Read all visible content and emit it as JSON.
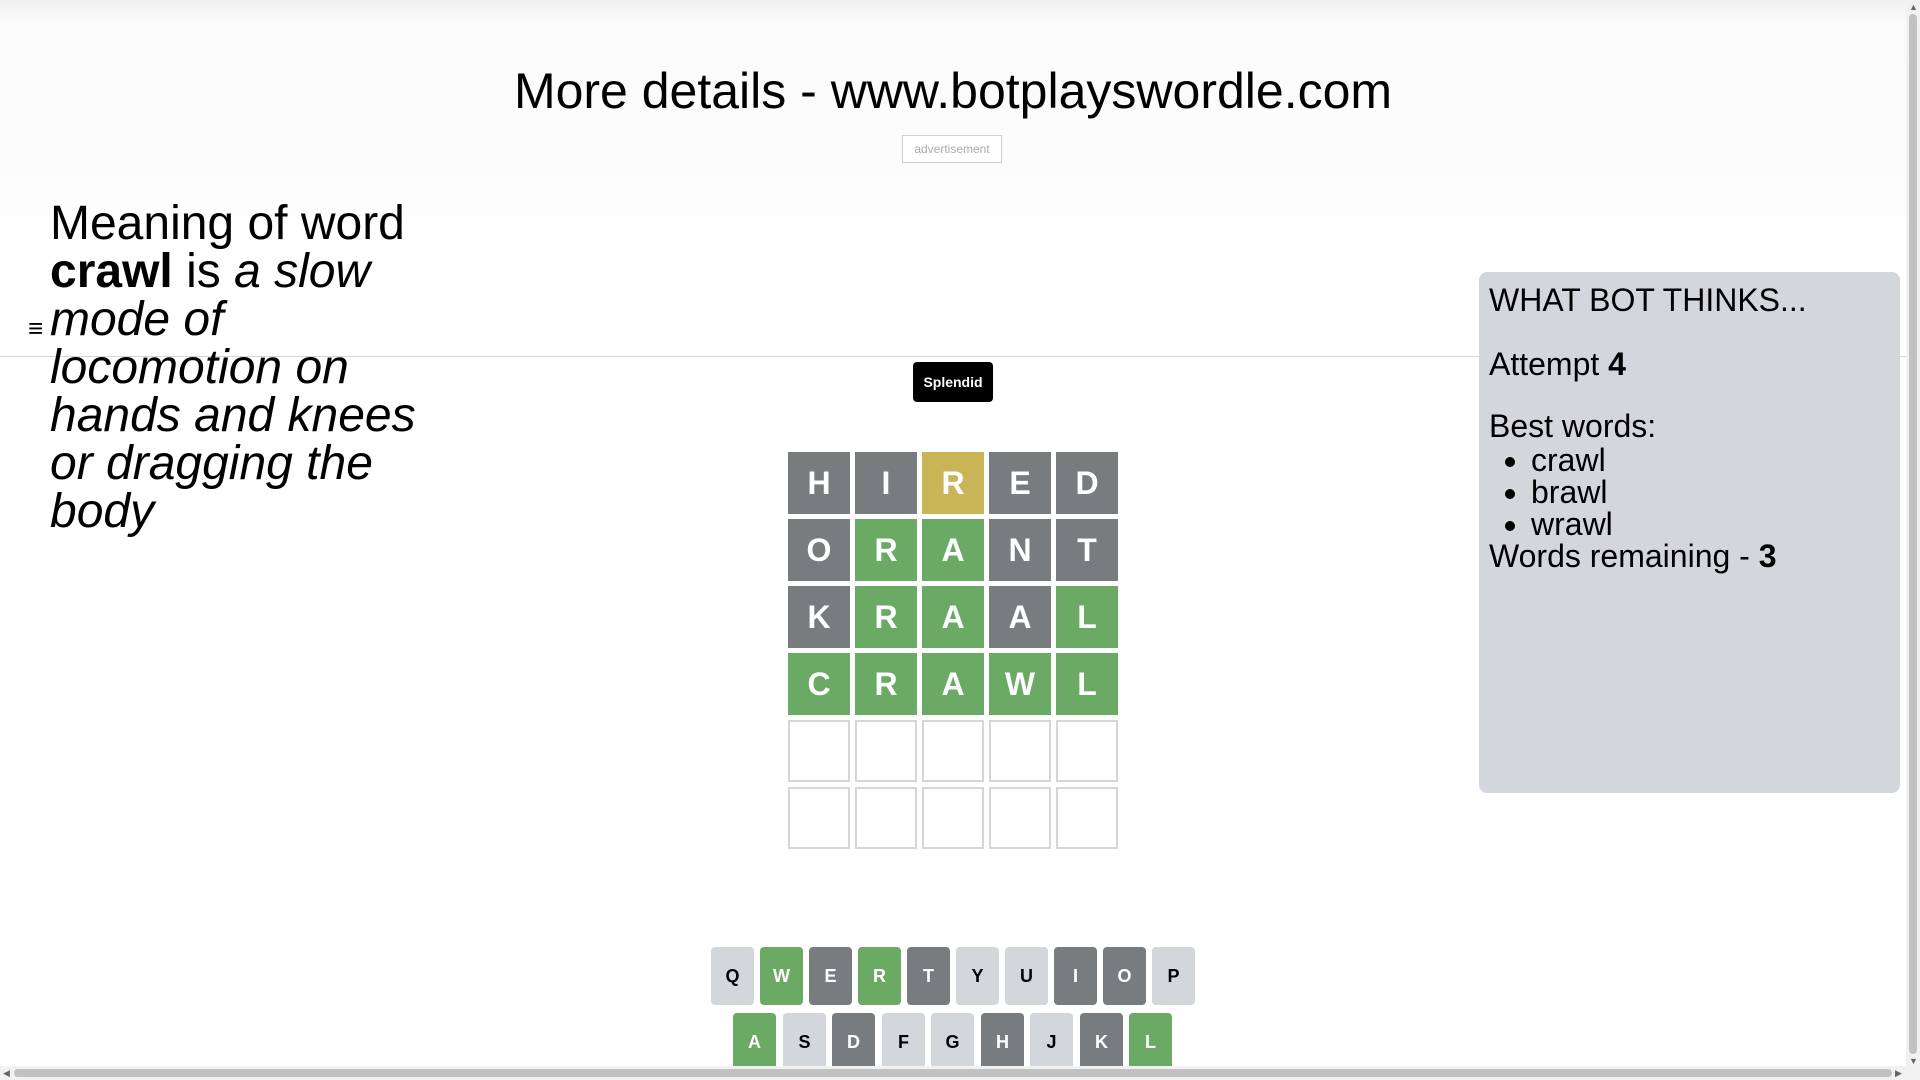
{
  "banner": {
    "text": "More details - www.botplayswordle.com"
  },
  "ad": {
    "label": "advertisement"
  },
  "meaning": {
    "prefix": "Meaning of word",
    "word": "crawl",
    "is": "is",
    "definition": "a slow mode of locomotion on hands and knees or dragging the body"
  },
  "menu": {
    "icon": "≡"
  },
  "toast": {
    "text": "Splendid"
  },
  "board": {
    "rows": [
      [
        {
          "letter": "H",
          "state": "absent"
        },
        {
          "letter": "I",
          "state": "absent"
        },
        {
          "letter": "R",
          "state": "present"
        },
        {
          "letter": "E",
          "state": "absent"
        },
        {
          "letter": "D",
          "state": "absent"
        }
      ],
      [
        {
          "letter": "O",
          "state": "absent"
        },
        {
          "letter": "R",
          "state": "correct"
        },
        {
          "letter": "A",
          "state": "correct"
        },
        {
          "letter": "N",
          "state": "absent"
        },
        {
          "letter": "T",
          "state": "absent"
        }
      ],
      [
        {
          "letter": "K",
          "state": "absent"
        },
        {
          "letter": "R",
          "state": "correct"
        },
        {
          "letter": "A",
          "state": "correct"
        },
        {
          "letter": "A",
          "state": "absent"
        },
        {
          "letter": "L",
          "state": "correct"
        }
      ],
      [
        {
          "letter": "C",
          "state": "correct"
        },
        {
          "letter": "R",
          "state": "correct"
        },
        {
          "letter": "A",
          "state": "correct"
        },
        {
          "letter": "W",
          "state": "correct"
        },
        {
          "letter": "L",
          "state": "correct"
        }
      ],
      [
        {
          "letter": "",
          "state": "empty"
        },
        {
          "letter": "",
          "state": "empty"
        },
        {
          "letter": "",
          "state": "empty"
        },
        {
          "letter": "",
          "state": "empty"
        },
        {
          "letter": "",
          "state": "empty"
        }
      ],
      [
        {
          "letter": "",
          "state": "empty"
        },
        {
          "letter": "",
          "state": "empty"
        },
        {
          "letter": "",
          "state": "empty"
        },
        {
          "letter": "",
          "state": "empty"
        },
        {
          "letter": "",
          "state": "empty"
        }
      ]
    ]
  },
  "keyboard": {
    "row1": [
      {
        "key": "Q",
        "state": "unused"
      },
      {
        "key": "W",
        "state": "correct"
      },
      {
        "key": "E",
        "state": "absent"
      },
      {
        "key": "R",
        "state": "correct"
      },
      {
        "key": "T",
        "state": "absent"
      },
      {
        "key": "Y",
        "state": "unused"
      },
      {
        "key": "U",
        "state": "unused"
      },
      {
        "key": "I",
        "state": "absent"
      },
      {
        "key": "O",
        "state": "absent"
      },
      {
        "key": "P",
        "state": "unused"
      }
    ],
    "row2": [
      {
        "key": "A",
        "state": "correct"
      },
      {
        "key": "S",
        "state": "unused"
      },
      {
        "key": "D",
        "state": "absent"
      },
      {
        "key": "F",
        "state": "unused"
      },
      {
        "key": "G",
        "state": "unused"
      },
      {
        "key": "H",
        "state": "absent"
      },
      {
        "key": "J",
        "state": "unused"
      },
      {
        "key": "K",
        "state": "absent"
      },
      {
        "key": "L",
        "state": "correct"
      }
    ]
  },
  "bot": {
    "title": "WHAT BOT THINKS...",
    "attempt_label": "Attempt",
    "attempt_value": "4",
    "best_label": "Best words:",
    "best_words": [
      "crawl",
      "brawl",
      "wrawl"
    ],
    "remaining_label": "Words remaining -",
    "remaining_value": "3"
  },
  "colors": {
    "absent": "#787c7e",
    "present": "#c9b458",
    "correct": "#6aaa64",
    "unused_key": "#d3d6da",
    "bot_panel": "#d3d6da"
  }
}
